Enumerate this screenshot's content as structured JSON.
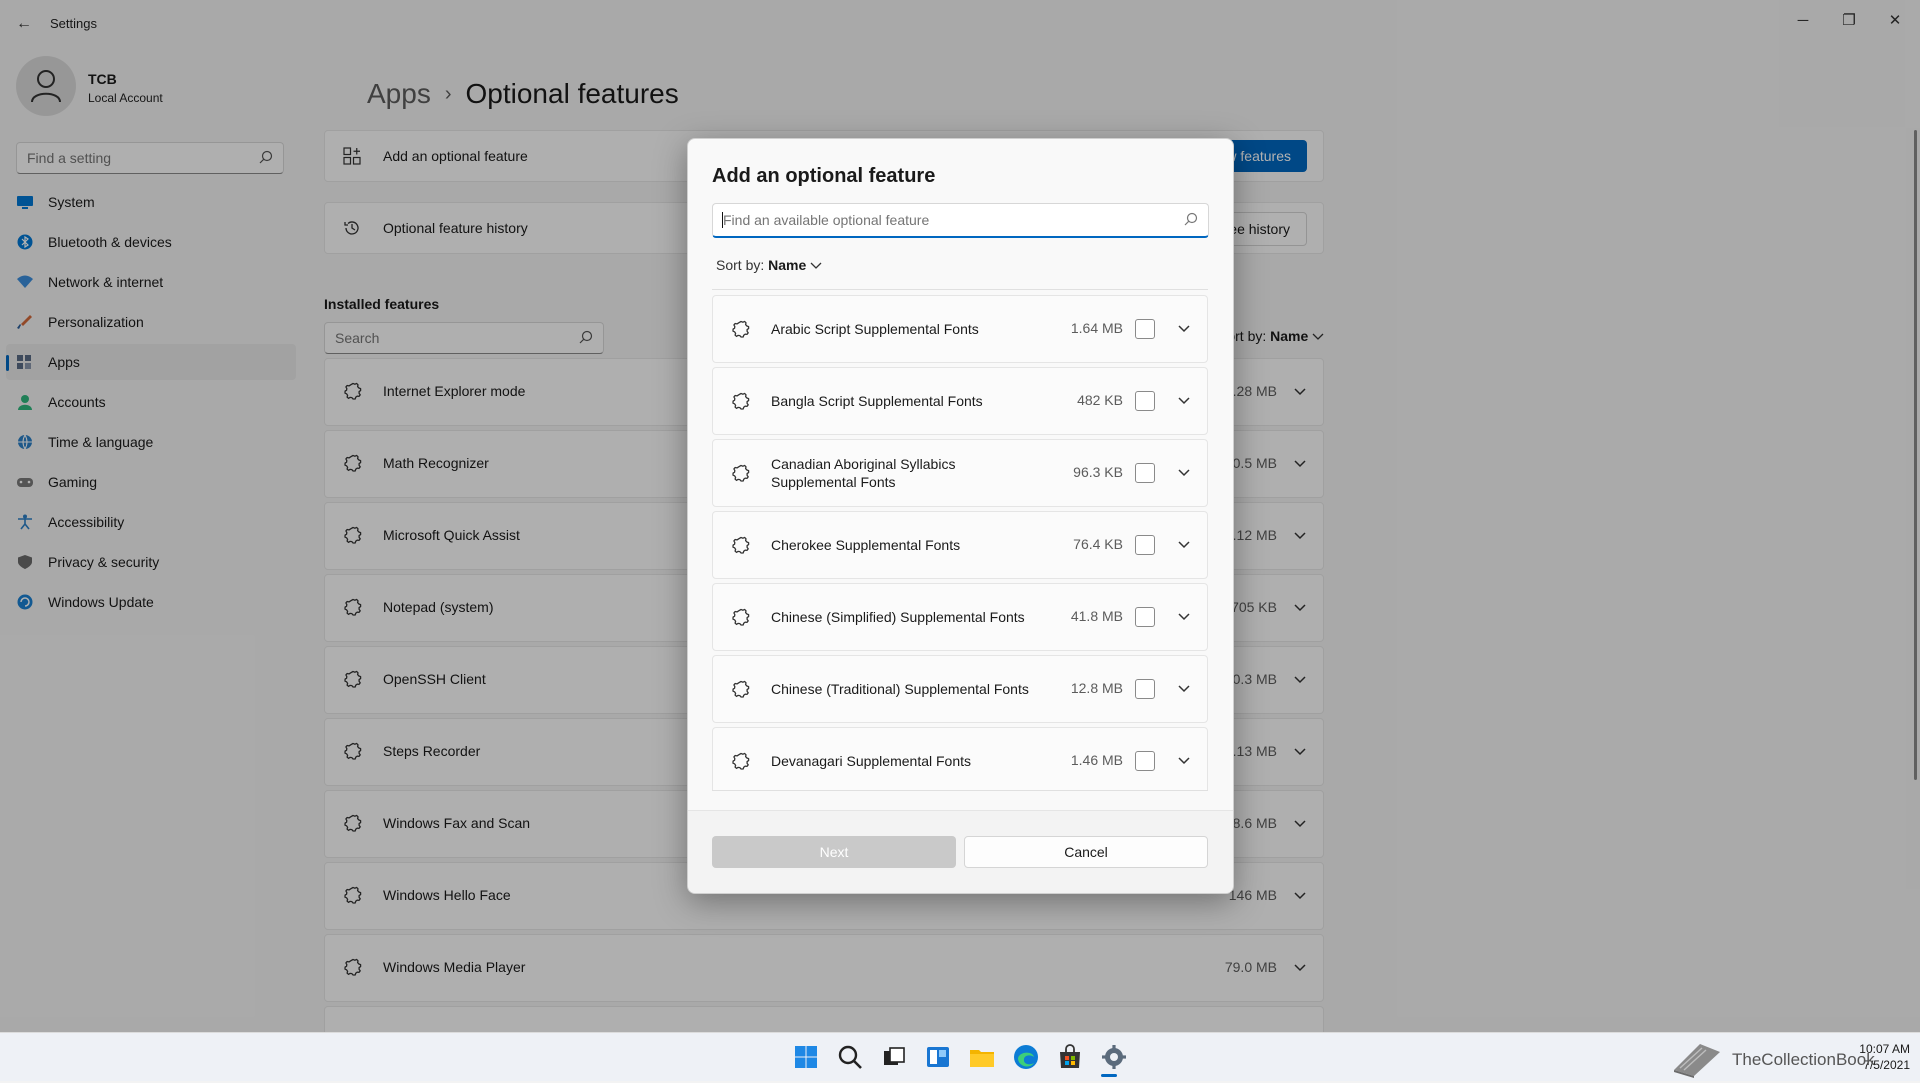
{
  "window": {
    "title": "Settings",
    "back_glyph": "←",
    "minimize_glyph": "─",
    "maximize_glyph": "❐",
    "close_glyph": "✕"
  },
  "profile": {
    "name": "TCB",
    "account_type": "Local Account"
  },
  "sidebar": {
    "search_placeholder": "Find a setting",
    "items": [
      {
        "label": "System",
        "icon": "system-icon",
        "color": "#0078d4"
      },
      {
        "label": "Bluetooth & devices",
        "icon": "bluetooth-icon",
        "color": "#0078d4"
      },
      {
        "label": "Network & internet",
        "icon": "wifi-icon",
        "color": "#3c8ddb"
      },
      {
        "label": "Personalization",
        "icon": "brush-icon",
        "color": "#d2693a"
      },
      {
        "label": "Apps",
        "icon": "apps-icon",
        "color": "#5a6b85"
      },
      {
        "label": "Accounts",
        "icon": "accounts-icon",
        "color": "#2eb67d"
      },
      {
        "label": "Time & language",
        "icon": "globe-icon",
        "color": "#2c7fc4"
      },
      {
        "label": "Gaming",
        "icon": "gaming-icon",
        "color": "#7a7a7a"
      },
      {
        "label": "Accessibility",
        "icon": "accessibility-icon",
        "color": "#2c7fc4"
      },
      {
        "label": "Privacy & security",
        "icon": "shield-icon",
        "color": "#6b6b6b"
      },
      {
        "label": "Windows Update",
        "icon": "update-icon",
        "color": "#1b80d1"
      }
    ],
    "active_item": "Apps"
  },
  "breadcrumb": {
    "parent": "Apps",
    "separator": "›",
    "current": "Optional features"
  },
  "main": {
    "add_feature_label": "Add an optional feature",
    "view_features_button": "View features",
    "history_label": "Optional feature history",
    "see_history_button": "See history",
    "installed_title": "Installed features",
    "search_placeholder": "Search",
    "sort_prefix": "Sort by:",
    "sort_value": "Name",
    "installed": [
      {
        "name": "Internet Explorer mode",
        "size": "3.28 MB"
      },
      {
        "name": "Math Recognizer",
        "size": "30.5 MB"
      },
      {
        "name": "Microsoft Quick Assist",
        "size": "3.12 MB"
      },
      {
        "name": "Notepad (system)",
        "size": "705 KB"
      },
      {
        "name": "OpenSSH Client",
        "size": "10.3 MB"
      },
      {
        "name": "Steps Recorder",
        "size": "1.13 MB"
      },
      {
        "name": "Windows Fax and Scan",
        "size": "18.6 MB"
      },
      {
        "name": "Windows Hello Face",
        "size": "146 MB"
      },
      {
        "name": "Windows Media Player",
        "size": "79.0 MB"
      }
    ]
  },
  "dialog": {
    "title": "Add an optional feature",
    "search_placeholder": "Find an available optional feature",
    "sort_prefix": "Sort by:",
    "sort_value": "Name",
    "options": [
      {
        "name": "Arabic Script Supplemental Fonts",
        "size": "1.64 MB",
        "checked": false
      },
      {
        "name": "Bangla Script Supplemental Fonts",
        "size": "482 KB",
        "checked": false
      },
      {
        "name": "Canadian Aboriginal Syllabics Supplemental Fonts",
        "size": "96.3 KB",
        "checked": false
      },
      {
        "name": "Cherokee Supplemental Fonts",
        "size": "76.4 KB",
        "checked": false
      },
      {
        "name": "Chinese (Simplified) Supplemental Fonts",
        "size": "41.8 MB",
        "checked": false
      },
      {
        "name": "Chinese (Traditional) Supplemental Fonts",
        "size": "12.8 MB",
        "checked": false
      },
      {
        "name": "Devanagari Supplemental Fonts",
        "size": "1.46 MB",
        "checked": false
      }
    ],
    "next_button": "Next",
    "cancel_button": "Cancel"
  },
  "taskbar": {
    "pinned": [
      "start-icon",
      "search-icon",
      "task-view-icon",
      "widgets-icon",
      "file-explorer-icon",
      "edge-icon",
      "store-icon",
      "settings-icon"
    ],
    "active": "settings-icon",
    "time": "10:07 AM",
    "date": "7/5/2021"
  },
  "watermark": {
    "text": "TheCollectionBook"
  },
  "colors": {
    "accent": "#0067c0",
    "background": "#f3f3f3"
  }
}
